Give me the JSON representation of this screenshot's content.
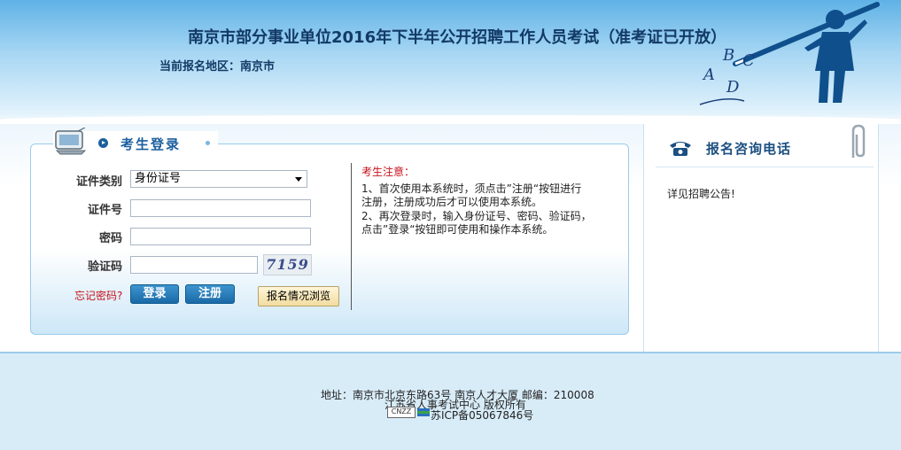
{
  "header": {
    "title": "南京市部分事业单位2016年下半年公开招聘工作人员考试（准考证已开放）",
    "region": "当前报名地区：南京市",
    "decor_letters": [
      "A",
      "B",
      "C",
      "D"
    ]
  },
  "login": {
    "section_title": "考生登录",
    "id_type_label": "证件类别",
    "id_type_value": "身份证号",
    "id_number_label": "证件号",
    "id_number_value": "",
    "password_label": "密码",
    "password_value": "",
    "captcha_label": "验证码",
    "captcha_value": "",
    "captcha_text": "7159",
    "forgot_label": "忘记密码?",
    "login_button": "登录",
    "register_button": "注册",
    "browse_button": "报名情况浏览"
  },
  "notice": {
    "title": "考生注意：",
    "lines": [
      "1、首次使用本系统时，须点击”注册“按钮进行",
      "注册，注册成功后才可以使用本系统。",
      "2、再次登录时，输入身份证号、密码、验证码，",
      "点击”登录“按钮即可使用和操作本系统。"
    ]
  },
  "side": {
    "title": "报名咨询电话",
    "text": "详见招聘公告!"
  },
  "footer": {
    "address": "地址：南京市北京东路63号 南京人才大厦 邮编：210008",
    "copyright": "江苏省人事考试中心 版权所有",
    "cnzz_badge": "CNZZ",
    "icp": "苏ICP备05067846号"
  },
  "colors": {
    "title_blue": "#123a66",
    "accent_blue": "#1b5f9e",
    "alert_red": "#c8131b"
  }
}
